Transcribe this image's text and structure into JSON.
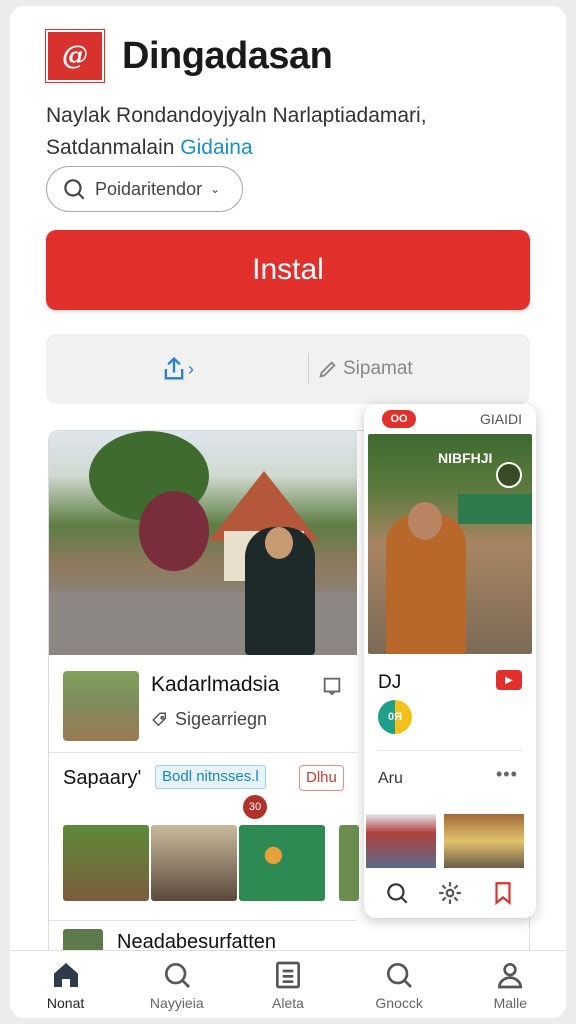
{
  "app": {
    "logo_text": "@",
    "title": "Dingadasan",
    "description_line1": "Naylak Rondandoyjyaln Narlaptiadamari,",
    "description_line2_plain": "Satdanmalain",
    "description_line2_link": "Gidaina"
  },
  "developer_chip": {
    "label": "Poidaritendor",
    "icon": "search-icon"
  },
  "install_button": {
    "label": "Instal",
    "color": "#e1302b"
  },
  "actions": {
    "share_chevron": "›",
    "secondary_label": "Sipamat"
  },
  "feed": {
    "row1": {
      "title": "Kadarlmadsia",
      "subtitle": "Sigearriegn"
    },
    "row2": {
      "title": "Sapaary'",
      "tag_blue": "Bodl nitnsses.l",
      "tag_red": "Dlhu",
      "badge": "30"
    },
    "row3": {
      "title": "Neadabesurfatten"
    }
  },
  "floating_card": {
    "logo": "OO",
    "code": "GIAIDI",
    "image_sign": "NIBFHJI",
    "title": "DJ",
    "yt_label": "▶",
    "circle_label": "0Я",
    "label": "Aru",
    "more": "•••"
  },
  "bottom_nav": [
    {
      "label": "Nonat",
      "icon": "home-icon",
      "active": true
    },
    {
      "label": "Nayyieia",
      "icon": "search-icon",
      "active": false
    },
    {
      "label": "Aleta",
      "icon": "list-icon",
      "active": false
    },
    {
      "label": "Gnocck",
      "icon": "search-icon",
      "active": false
    },
    {
      "label": "Malle",
      "icon": "profile-icon",
      "active": false
    }
  ],
  "colors": {
    "accent": "#e1302b",
    "link": "#1a8fc8"
  }
}
